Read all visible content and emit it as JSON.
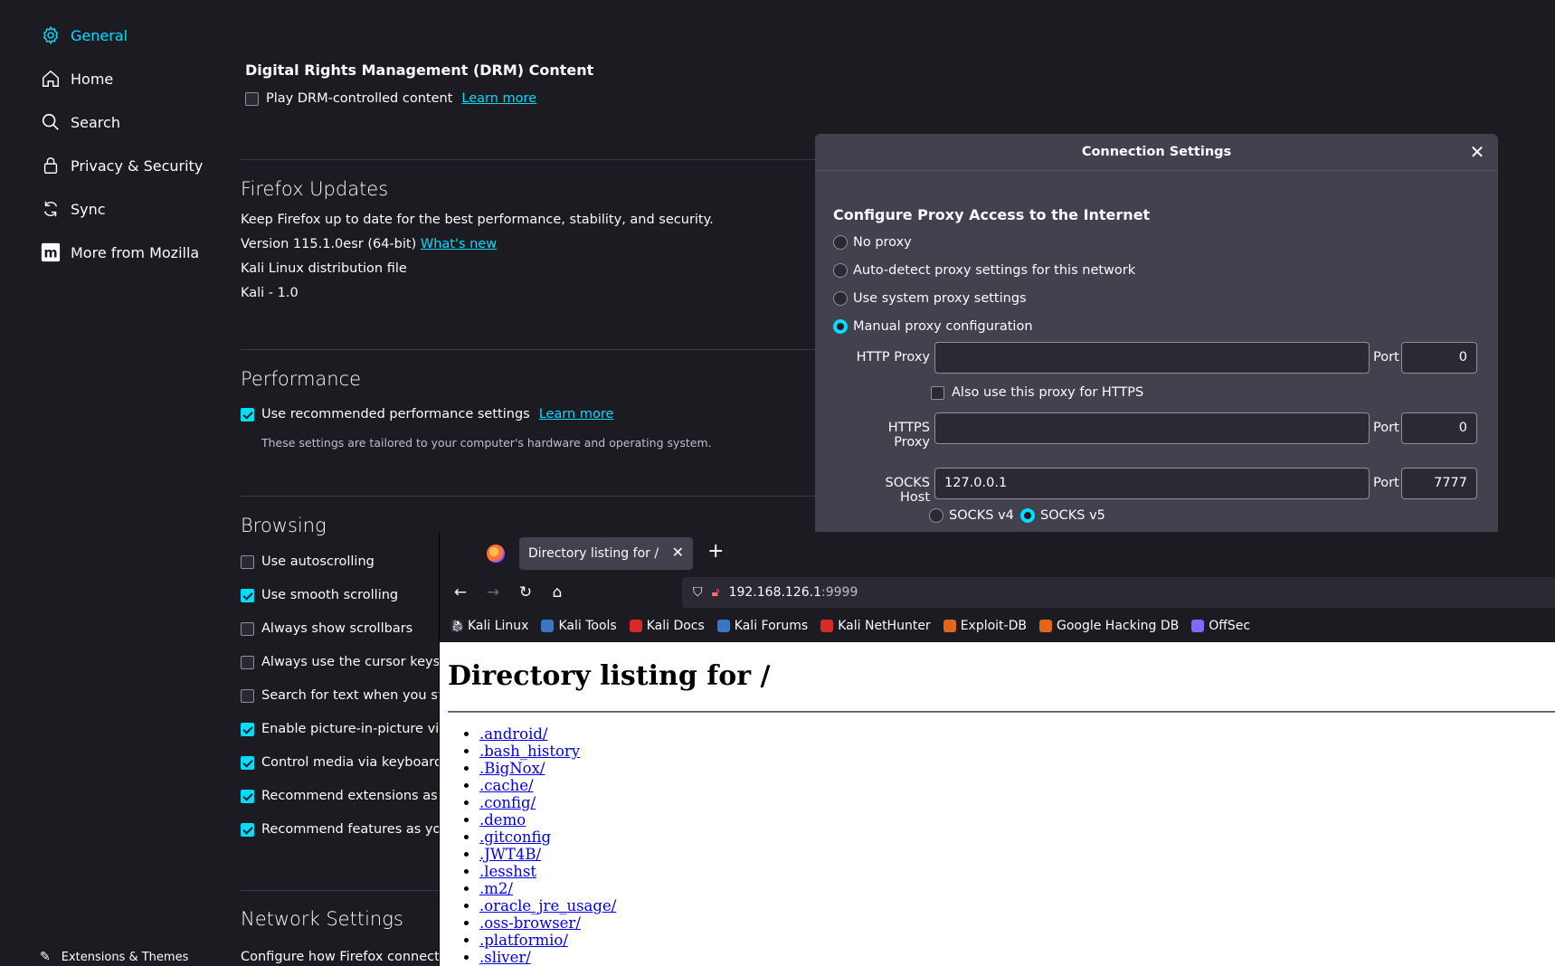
{
  "sidebar": {
    "items": [
      {
        "label": "General",
        "icon": "gear-icon"
      },
      {
        "label": "Home",
        "icon": "home-icon"
      },
      {
        "label": "Search",
        "icon": "search-icon"
      },
      {
        "label": "Privacy & Security",
        "icon": "lock-icon"
      },
      {
        "label": "Sync",
        "icon": "sync-icon"
      },
      {
        "label": "More from Mozilla",
        "icon": "mozilla-icon"
      }
    ],
    "extensions_label": "Extensions & Themes"
  },
  "drm": {
    "title": "Digital Rights Management (DRM) Content",
    "checkbox_label": "Play DRM-controlled content",
    "learn_more": "Learn more"
  },
  "updates": {
    "title": "Firefox Updates",
    "desc": "Keep Firefox up to date for the best performance, stability, and security.",
    "version": "Version 115.1.0esr (64-bit)",
    "whats_new": "What's new",
    "distribution": "Kali Linux distribution file",
    "kali_version": "Kali - 1.0"
  },
  "performance": {
    "title": "Performance",
    "checkbox_label": "Use recommended performance settings",
    "learn_more": "Learn more",
    "note": "These settings are tailored to your computer's hardware and operating system."
  },
  "browsing": {
    "title": "Browsing",
    "options": [
      {
        "label": "Use autoscrolling",
        "checked": false
      },
      {
        "label": "Use smooth scrolling",
        "checked": true
      },
      {
        "label": "Always show scrollbars",
        "checked": false
      },
      {
        "label": "Always use the cursor keys to",
        "checked": false
      },
      {
        "label": "Search for text when you start",
        "checked": false
      },
      {
        "label": "Enable picture-in-picture vide",
        "checked": true
      },
      {
        "label": "Control media via keyboard, h",
        "checked": true
      },
      {
        "label": "Recommend extensions as yo",
        "checked": true
      },
      {
        "label": "Recommend features as you b",
        "checked": true
      }
    ]
  },
  "network": {
    "title": "Network Settings",
    "desc": "Configure how Firefox connects t"
  },
  "dialog": {
    "title": "Connection Settings",
    "heading": "Configure Proxy Access to the Internet",
    "radios": [
      {
        "label": "No proxy",
        "selected": false
      },
      {
        "label": "Auto-detect proxy settings for this network",
        "selected": false
      },
      {
        "label": "Use system proxy settings",
        "selected": false
      },
      {
        "label": "Manual proxy configuration",
        "selected": true
      }
    ],
    "http_proxy_label": "HTTP Proxy",
    "http_proxy_value": "",
    "http_port": "0",
    "port_label": "Port",
    "also_https_label": "Also use this proxy for HTTPS",
    "https_proxy_label": "HTTPS Proxy",
    "https_proxy_value": "",
    "https_port": "0",
    "socks_host_label": "SOCKS Host",
    "socks_host_value": "127.0.0.1",
    "socks_port": "7777",
    "socks_v4": "SOCKS v4",
    "socks_v5": "SOCKS v5"
  },
  "browser": {
    "tab_title": "Directory listing for /",
    "url_host": "192.168.126.1",
    "url_port": ":9999",
    "bookmarks": [
      {
        "label": "Kali Linux",
        "color": "#2b2a33"
      },
      {
        "label": "Kali Tools",
        "color": "#3a76c4"
      },
      {
        "label": "Kali Docs",
        "color": "#d92a2a"
      },
      {
        "label": "Kali Forums",
        "color": "#3a76c4"
      },
      {
        "label": "Kali NetHunter",
        "color": "#d92a2a"
      },
      {
        "label": "Exploit-DB",
        "color": "#e3661a"
      },
      {
        "label": "Google Hacking DB",
        "color": "#e3661a"
      },
      {
        "label": "OffSec",
        "color": "#7b6cff"
      }
    ],
    "page_heading": "Directory listing for /",
    "files": [
      ".android/",
      ".bash_history",
      ".BigNox/",
      ".cache/",
      ".config/",
      ".demo",
      ".gitconfig",
      ".JWT4B/",
      ".lesshst",
      ".m2/",
      ".oracle_jre_usage/",
      ".oss-browser/",
      ".platformio/",
      ".sliver/"
    ]
  },
  "colors": {
    "accent": "#00ddff",
    "bg": "#1c1b22",
    "dialog_bg": "#42414d"
  }
}
